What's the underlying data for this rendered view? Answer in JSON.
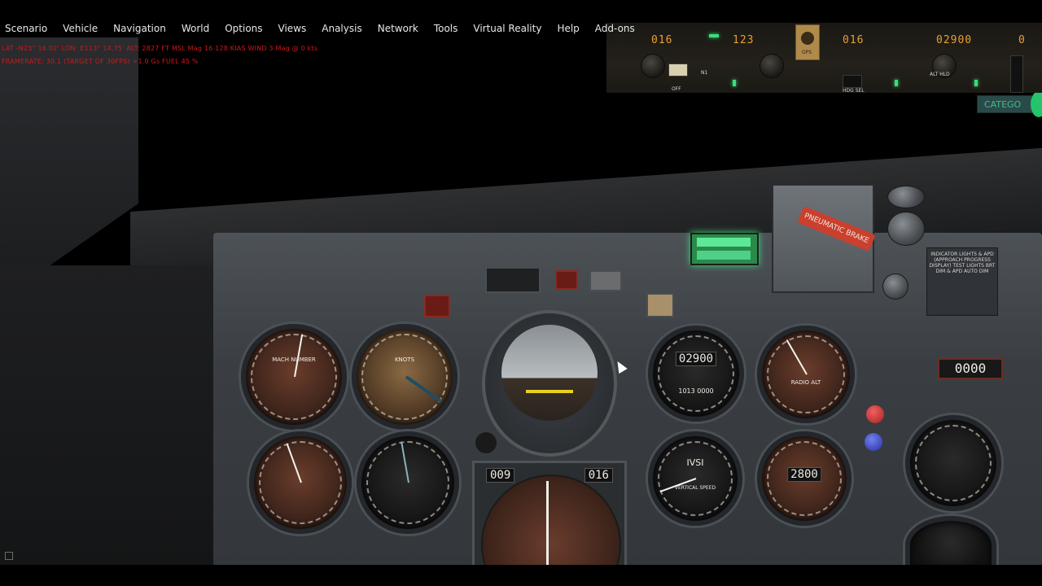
{
  "menu": {
    "items": [
      "Scenario",
      "Vehicle",
      "Navigation",
      "World",
      "Options",
      "Views",
      "Analysis",
      "Network",
      "Tools",
      "Virtual Reality",
      "Help",
      "Add-ons"
    ]
  },
  "status": {
    "line1": "LAT -N23° 16.02' LON: E113° 14.75' ALT: 2827 FT MSL Mag 16 128 KIAS WIND 3 Mag @ 0 kts",
    "line2": "FRAMERATE: 30.1 (TARGET OF 30FPS) +1.0 Gs FUEL 45 %"
  },
  "mcp": {
    "course_left": "016",
    "ias": "123",
    "heading": "016",
    "altitude": "02900",
    "vs": "0",
    "gps_label": "GPS",
    "off_label": "OFF",
    "n1_label": "N1",
    "hdg_sel_label": "HDG SEL",
    "alt_hld_label": "ALT HLD"
  },
  "category_button": "CATEGO",
  "panel": {
    "pneumatic_brake": "PNEUMATIC BRAKE",
    "placard": "INDICATOR LIGHTS & APD (APPROACH PROGRESS DISPLAY) TEST LIGHTS BRT DIM & APD AUTO DIM",
    "radio_alt_counter": "0000",
    "mach_label": "MACH NUMBER",
    "knots_label": "KNOTS",
    "alt_readout": "02900",
    "alt_sub": "1013 0000",
    "radio_alt_label": "RADIO ALT",
    "ivsi_label": "IVSI",
    "vertical_speed_label": "VERTICAL SPEED",
    "alt2_readout": "2800",
    "hsi_course": "009",
    "hsi_distance": "016"
  },
  "colors": {
    "menu_text": "#e8e8e8",
    "status_text": "#d01818",
    "mcp_digits": "#e8a030",
    "annunciator_green": "#3ce07c",
    "brake_red": "#c9402e"
  }
}
